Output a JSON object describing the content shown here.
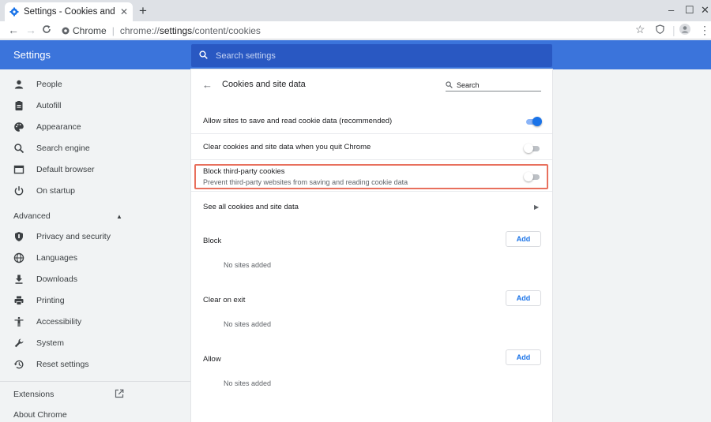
{
  "tab": {
    "title": "Settings - Cookies and site data",
    "close": "✕"
  },
  "window": {
    "new_tab": "+",
    "minimize": "–",
    "maximize": "☐",
    "close": "✕"
  },
  "toolbar": {
    "back": "←",
    "forward": "→",
    "reload": "C",
    "site_name": "Chrome",
    "url_scheme": "chrome://",
    "url_host": "settings",
    "url_path": "/content/cookies",
    "star": "☆",
    "menu": "⋮"
  },
  "header": {
    "title": "Settings",
    "search_placeholder": "Search settings"
  },
  "sidebar": {
    "items": [
      {
        "label": "People",
        "icon": "person-icon"
      },
      {
        "label": "Autofill",
        "icon": "clipboard-icon"
      },
      {
        "label": "Appearance",
        "icon": "palette-icon"
      },
      {
        "label": "Search engine",
        "icon": "search-icon"
      },
      {
        "label": "Default browser",
        "icon": "browser-icon"
      },
      {
        "label": "On startup",
        "icon": "power-icon"
      }
    ],
    "advanced_label": "Advanced",
    "advanced_items": [
      {
        "label": "Privacy and security",
        "icon": "shield-icon"
      },
      {
        "label": "Languages",
        "icon": "globe-icon"
      },
      {
        "label": "Downloads",
        "icon": "download-icon"
      },
      {
        "label": "Printing",
        "icon": "printer-icon"
      },
      {
        "label": "Accessibility",
        "icon": "accessibility-icon"
      },
      {
        "label": "System",
        "icon": "wrench-icon"
      },
      {
        "label": "Reset settings",
        "icon": "restore-icon"
      }
    ],
    "extensions_label": "Extensions",
    "about_label": "About Chrome"
  },
  "main": {
    "title": "Cookies and site data",
    "search_placeholder": "Search",
    "settings": [
      {
        "label": "Allow sites to save and read cookie data (recommended)",
        "enabled": true
      },
      {
        "label": "Clear cookies and site data when you quit Chrome",
        "enabled": false
      },
      {
        "label": "Block third-party cookies",
        "sublabel": "Prevent third-party websites from saving and reading cookie data",
        "enabled": false
      }
    ],
    "see_all": "See all cookies and site data",
    "groups": [
      {
        "title": "Block",
        "button": "Add",
        "empty": "No sites added"
      },
      {
        "title": "Clear on exit",
        "button": "Add",
        "empty": "No sites added"
      },
      {
        "title": "Allow",
        "button": "Add",
        "empty": "No sites added"
      }
    ]
  },
  "colors": {
    "accent": "#1a73e8",
    "header": "#3b74db",
    "search_bg": "#2958c2",
    "highlight": "#e8705d"
  }
}
